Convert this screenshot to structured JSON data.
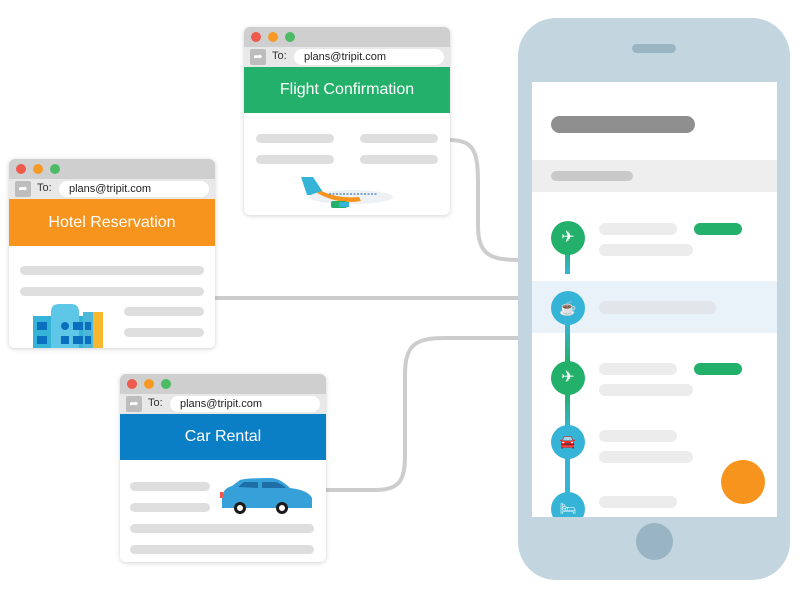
{
  "colors": {
    "flight": "#23b06a",
    "hotel": "#f7941d",
    "car": "#0a7fc6",
    "timeline_blue": "#36b4d8",
    "phone_body": "#c3d6e0",
    "connector": "#cdcdcd",
    "fab": "#f7941d"
  },
  "cards": {
    "flight": {
      "to_label": "To:",
      "to_value": "plans@tripit.com",
      "title": "Flight Confirmation",
      "icon": "airplane-icon"
    },
    "hotel": {
      "to_label": "To:",
      "to_value": "plans@tripit.com",
      "title": "Hotel Reservation",
      "icon": "hotel-building-icon"
    },
    "car": {
      "to_label": "To:",
      "to_value": "plans@tripit.com",
      "title": "Car Rental",
      "icon": "car-icon"
    }
  },
  "phone": {
    "timeline": [
      {
        "type": "flight",
        "icon": "airplane-icon",
        "glyph": "✈",
        "has_badge": true
      },
      {
        "type": "meal",
        "icon": "coffee-cup-icon",
        "glyph": "☕",
        "highlighted": true
      },
      {
        "type": "flight",
        "icon": "airplane-icon",
        "glyph": "✈",
        "has_badge": true
      },
      {
        "type": "car",
        "icon": "car-icon",
        "glyph": "🚘"
      },
      {
        "type": "hotel",
        "icon": "bed-icon",
        "glyph": "🛏"
      }
    ],
    "fab_icon": "add-plan-button"
  }
}
